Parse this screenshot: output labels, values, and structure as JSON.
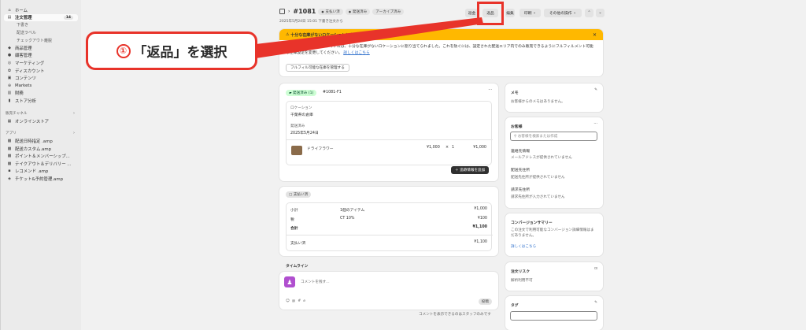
{
  "sidebar": {
    "items": [
      {
        "icon": "home-icon",
        "glyph": "⌂",
        "label": "ホーム"
      },
      {
        "icon": "orders-icon",
        "glyph": "▤",
        "label": "注文管理",
        "count": "14",
        "active": true
      },
      {
        "label": "下書き",
        "sub": true
      },
      {
        "label": "配送ラベル",
        "sub": true
      },
      {
        "label": "チェックアウト離脱",
        "sub": true
      },
      {
        "icon": "tag-icon",
        "glyph": "◆",
        "label": "商品管理"
      },
      {
        "icon": "person-icon",
        "glyph": "●",
        "label": "顧客管理"
      },
      {
        "icon": "target-icon",
        "glyph": "◎",
        "label": "マーケティング"
      },
      {
        "icon": "discount-icon",
        "glyph": "✿",
        "label": "ディスカウント"
      },
      {
        "icon": "content-icon",
        "glyph": "▣",
        "label": "コンテンツ"
      },
      {
        "icon": "globe-icon",
        "glyph": "⊕",
        "label": "Markets"
      },
      {
        "icon": "bank-icon",
        "glyph": "▥",
        "label": "財務"
      },
      {
        "icon": "chart-icon",
        "glyph": "▮",
        "label": "ストア分析"
      }
    ],
    "channels_section": "販売チャネル",
    "channels": [
      {
        "icon": "store-icon",
        "glyph": "▦",
        "label": "オンラインストア"
      }
    ],
    "apps_section": "アプリ",
    "apps": [
      {
        "icon": "app-icon",
        "glyph": "▩",
        "label": "配送日時指定 .amp"
      },
      {
        "icon": "app-icon",
        "glyph": "▩",
        "label": "配送カスタム.amp"
      },
      {
        "icon": "app-icon",
        "glyph": "▩",
        "label": "ポイント＆メンバーシップ..."
      },
      {
        "icon": "app-icon",
        "glyph": "▩",
        "label": "テイクアウト＆デリバリー ..."
      },
      {
        "icon": "app-icon",
        "glyph": "▪",
        "label": "レコメンド .amp"
      },
      {
        "icon": "app-icon",
        "glyph": "◈",
        "label": "チケット&予約管理.amp"
      }
    ]
  },
  "header": {
    "order_number": "#1081",
    "badges": [
      "支払い済",
      "発送済み",
      "アーカイブ済み"
    ],
    "subtitle": "2025年5月24日 15:01 下書き注文から",
    "buttons": {
      "restock": "返金",
      "return": "返品",
      "edit": "編集",
      "print": "印刷",
      "more": "その他の操作"
    }
  },
  "callout": {
    "number": "①",
    "text": "「返品」を選択"
  },
  "banner": {
    "title": "十分な在庫がないロケーションにあるアイテム",
    "body": "この注文内の1個以上のアイテムは、十分な在庫がないロケーションに割り当てられました。これを防ぐには、設定された配送エリア内でのみ販売できるようにフルフィルメント可能な在庫設定を変更してください。",
    "link": "詳しくはこちら",
    "button": "フルフィル可能な在庫を管理する"
  },
  "fulfillment": {
    "status": "発送済み (1)",
    "id": "#1081-F1",
    "location_label": "ロケーション",
    "location": "千葉県の倉庫",
    "shipped_label": "発送済み",
    "shipped_date": "2025年5月24日",
    "item_name": "ドライフラワー",
    "item_price": "¥1,000",
    "qty_sep": "×",
    "item_qty": "1",
    "item_total": "¥1,000",
    "tracking_button": "追跡情報を追加"
  },
  "payment": {
    "status": "支払い済",
    "subtotal_label": "小計",
    "subtotal_desc": "1個のアイテム",
    "subtotal": "¥1,000",
    "tax_label": "税",
    "tax_desc": "CT 10%",
    "tax": "¥100",
    "total_label": "合計",
    "total": "¥1,100",
    "paid_label": "支払い済",
    "paid": "¥1,100"
  },
  "timeline": {
    "title": "タイムライン",
    "placeholder": "コメントを残す...",
    "post_button": "投稿",
    "footer_note": "コメントを表示できるのはスタッフのみです"
  },
  "notes": {
    "title": "メモ",
    "text": "お客様からのメモはありません。"
  },
  "customer": {
    "title": "お客様",
    "search_placeholder": "お客様を検索または作成",
    "contact_label": "連絡先情報",
    "contact_value": "メールアドレスが提供されていません",
    "shipping_label": "配送先住所",
    "shipping_value": "配送先住所が提供されていません",
    "billing_label": "請求先住所",
    "billing_value": "請求先住所が入力されていません"
  },
  "conversion": {
    "title": "コンバージョンサマリー",
    "text": "この注文で利用可能なコンバージョン詳細情報はまだありません。",
    "link": "詳しくはこちら"
  },
  "risk": {
    "title": "注文リスク",
    "text": "解析利用不可"
  },
  "tags": {
    "title": "タグ"
  },
  "colors": {
    "accent_red": "#e8332a",
    "banner_yellow": "#ffb800",
    "fulfilled_green": "#cdfed4"
  }
}
